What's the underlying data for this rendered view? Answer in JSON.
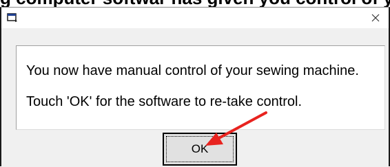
{
  "caption": {
    "text": "g computer softwar has given you control of your"
  },
  "dialog": {
    "title": "",
    "close_icon": "close-icon",
    "app_icon": "window-app-icon",
    "message": {
      "line1": "You now have manual control of your sewing machine.",
      "line2": "Touch 'OK' for the software to re-take control."
    },
    "ok_label": "OK"
  },
  "annotation": {
    "arrow_icon": "red-arrow-icon",
    "arrow_color": "#e8231f"
  },
  "colors": {
    "dialog_background": "#f0f0f0",
    "message_background": "#ffffff",
    "button_background": "#e1e1e1"
  }
}
